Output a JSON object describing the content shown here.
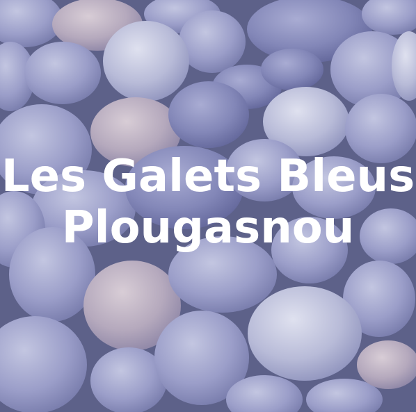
{
  "image": {
    "subject": "blue-grey beach pebbles",
    "palette": {
      "background": "#6f7398",
      "pebble_light": "#c7c9e0",
      "pebble_mid": "#9a9dc6",
      "pebble_dark": "#7c80b2",
      "pebble_warm": "#b6a8b8",
      "text": "#ffffff"
    }
  },
  "title": {
    "line1": "Les Galets Bleus",
    "line2": "Plougasnou"
  }
}
